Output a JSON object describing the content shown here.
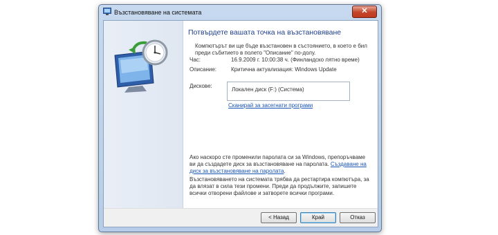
{
  "window": {
    "title": "Възстановяване на системата",
    "close_label": "✕"
  },
  "main": {
    "heading": "Потвърдете вашата точка на възстановяване",
    "info_line1": "Компютърът ви ще бъде възстановен в състоянието, в което е бил",
    "info_line2": "преди събитието в полето \"Описание\" по-долу.",
    "time_label": "Час:",
    "time_value": "16.9.2009 г. 10:00:38 ч. (Финландско лятно време)",
    "description_label": "Описание:",
    "description_value": "Критична актуализация: Windows Update",
    "disks_label": "Дискове:",
    "disk_item": "Локален диск (F:) (Система)",
    "scan_link": "Сканирай за засегнати програми",
    "password_text": "Ако наскоро сте променили паролата си за Windows, препоръчваме ви да създадете диск за възстановяване на паролата.",
    "password_link": "Създаване на диск за възстановяване на паролата",
    "restart_text": "Възстановяването на системата трябва да рестартира компютъра, за да влязат в сила тези промени. Преди да продължите, запишете всички отворени файлове и затворете всички програми."
  },
  "buttons": {
    "back": "< Назад",
    "finish": "Край",
    "cancel": "Отказ"
  },
  "icons": [
    "system-restore-icon",
    "restore-clock-illustration",
    "close-icon"
  ]
}
